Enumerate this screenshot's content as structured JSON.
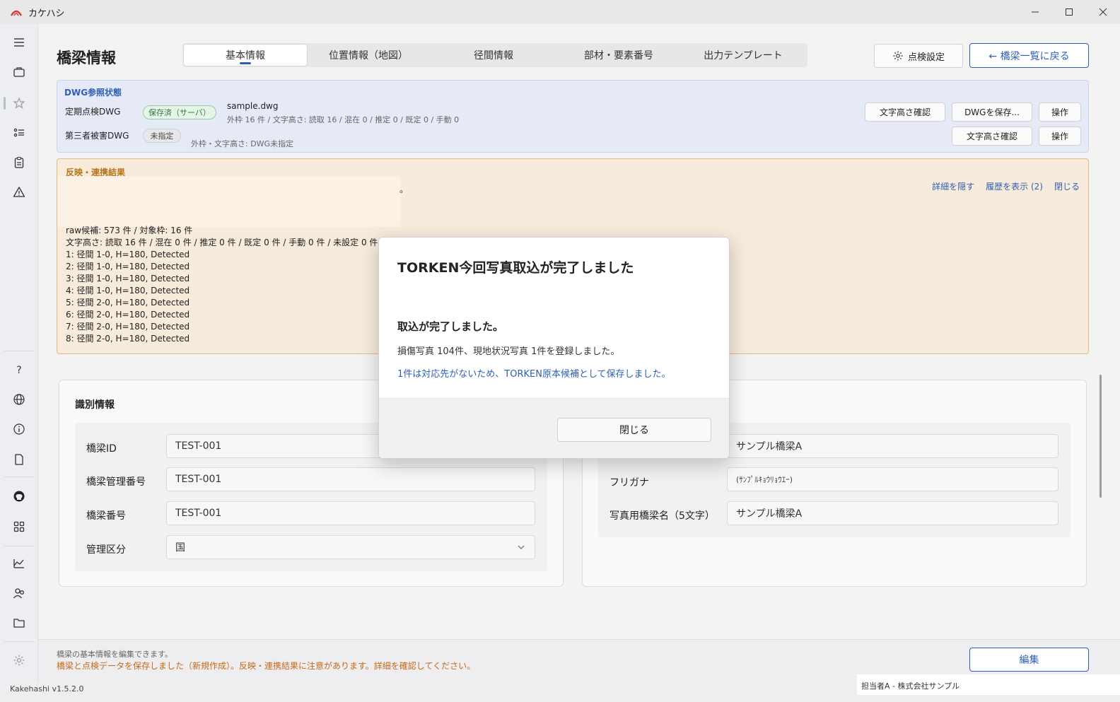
{
  "titlebar": {
    "app_name": "カケハシ"
  },
  "page": {
    "title": "橋梁情報",
    "tabs": [
      "基本情報",
      "位置情報（地図）",
      "径間情報",
      "部材・要素番号",
      "出力テンプレート"
    ],
    "inspect_settings_label": "点検設定",
    "back_label": "← 橋梁一覧に戻る"
  },
  "dwg": {
    "title": "DWG参照状態",
    "rows": [
      {
        "label": "定期点検DWG",
        "status": "保存済（サーバ）",
        "file": "sample.dwg",
        "meta": "外枠 16 件 / 文字高さ: 読取 16 / 混在 0 / 推定 0 / 既定 0 / 手動 0",
        "btn_check": "文字高さ確認",
        "btn_save": "DWGを保存...",
        "btn_op": "操作"
      },
      {
        "label": "第三者被害DWG",
        "status": "未指定",
        "meta": "外枠・文字高さ: DWG未指定",
        "btn_check": "文字高さ確認",
        "btn_op": "操作"
      }
    ]
  },
  "result": {
    "title": "反映・連携結果",
    "tail": "。",
    "links": {
      "hide": "詳細を隠す",
      "history": "履歴を表示 (2)",
      "close": "閉じる"
    },
    "lines": [
      "raw候補: 573 件 / 対象枠: 16 件",
      "文字高さ: 読取 16 件 / 混在 0 件 / 推定 0 件 / 既定 0 件 / 手動 0 件 / 未設定 0 件",
      "1: 径間 1-0, H=180, Detected",
      "2: 径間 1-0, H=180, Detected",
      "3: 径間 1-0, H=180, Detected",
      "4: 径間 1-0, H=180, Detected",
      "5: 径間 2-0, H=180, Detected",
      "6: 径間 2-0, H=180, Detected",
      "7: 径間 2-0, H=180, Detected",
      "8: 径間 2-0, H=180, Detected"
    ]
  },
  "ident": {
    "title": "識別情報",
    "fields": [
      {
        "label": "橋梁ID",
        "value": "TEST-001"
      },
      {
        "label": "橋梁管理番号",
        "value": "TEST-001"
      },
      {
        "label": "橋梁番号",
        "value": "TEST-001"
      },
      {
        "label": "管理区分",
        "value": "国"
      }
    ]
  },
  "name_card": {
    "fields": [
      {
        "label": "",
        "value": "サンプル橋梁A"
      },
      {
        "label": "フリガナ",
        "value": "(ｻﾝﾌﾟﾙｷｮｳﾘｮｳｴｰ)"
      },
      {
        "label": "写真用橋梁名（5文字）",
        "value": "サンプル橋梁A"
      }
    ]
  },
  "footer": {
    "info": "橋梁の基本情報を編集できます。",
    "warning": "橋梁と点検データを保存しました（新規作成）。反映・連携結果に注意があります。詳細を確認してください。",
    "edit_label": "編集",
    "version": "Kakehashi v1.5.2.0",
    "user": "担当者A - 株式会社サンプル"
  },
  "modal": {
    "title": "TORKEN今回写真取込が完了しました",
    "subtitle": "取込が完了しました。",
    "text": "損傷写真 104件、現地状況写真 1件を登録しました。",
    "note": "1件は対応先がないため、TORKEN原本候補として保存しました。",
    "close_label": "閉じる"
  },
  "colors": {
    "accent": "#2f5fb3",
    "warning": "#c46a16",
    "success": "#2f7a3f"
  },
  "icons": [
    "menu-icon",
    "briefcase-icon",
    "star-icon",
    "list-icon",
    "clipboard-icon",
    "warning-icon",
    "help-icon",
    "globe-icon",
    "info-icon",
    "document-icon",
    "github-icon",
    "apps-icon",
    "chart-icon",
    "users-icon",
    "folder-icon",
    "settings-icon",
    "gear-icon",
    "chevron-down-icon"
  ]
}
